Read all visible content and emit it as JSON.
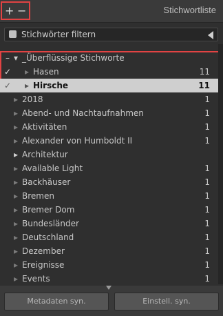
{
  "header": {
    "plus_label": "+",
    "minus_label": "−",
    "title": "Stichwortliste"
  },
  "filter": {
    "label": "Stichwörter filtern"
  },
  "group": {
    "label": "_Überflüssige Stichworte",
    "items": [
      {
        "label": "Hasen",
        "count": "11",
        "checked": "✓"
      },
      {
        "label": "Hirsche",
        "count": "11",
        "checked": "✓"
      }
    ]
  },
  "keywords": [
    {
      "label": "2018",
      "count": "1"
    },
    {
      "label": "Abend- und Nachtaufnahmen",
      "count": "1"
    },
    {
      "label": "Aktivitäten",
      "count": "1"
    },
    {
      "label": "Alexander von Humboldt II",
      "count": "1"
    },
    {
      "label": "Architektur",
      "count": ""
    },
    {
      "label": "Available Light",
      "count": "1"
    },
    {
      "label": "Backhäuser",
      "count": "1"
    },
    {
      "label": "Bremen",
      "count": "1"
    },
    {
      "label": "Bremer Dom",
      "count": "1"
    },
    {
      "label": "Bundesländer",
      "count": "1"
    },
    {
      "label": "Deutschland",
      "count": "1"
    },
    {
      "label": "Dezember",
      "count": "1"
    },
    {
      "label": "Ereignisse",
      "count": "1"
    },
    {
      "label": "Events",
      "count": "1"
    }
  ],
  "footer": {
    "meta_label": "Metadaten syn.",
    "settings_label": "Einstell. syn."
  }
}
